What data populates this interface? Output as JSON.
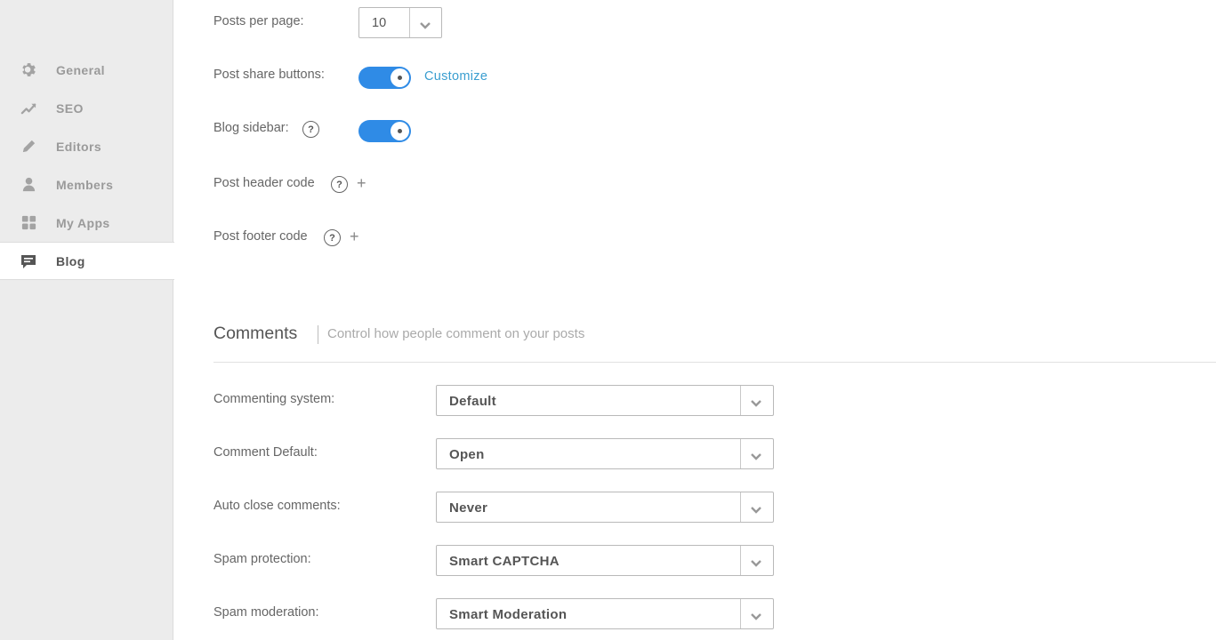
{
  "sidebar": {
    "items": [
      {
        "label": "General",
        "icon": "gear-icon"
      },
      {
        "label": "SEO",
        "icon": "trend-icon"
      },
      {
        "label": "Editors",
        "icon": "pencil-icon"
      },
      {
        "label": "Members",
        "icon": "person-icon"
      },
      {
        "label": "My Apps",
        "icon": "grid-icon"
      },
      {
        "label": "Blog",
        "icon": "comment-icon",
        "active": true
      }
    ]
  },
  "blog": {
    "posts_per_page_label": "Posts per page:",
    "posts_per_page_value": "10",
    "share_buttons_label": "Post share buttons:",
    "share_buttons_on": true,
    "customize_label": "Customize",
    "sidebar_label": "Blog sidebar:",
    "sidebar_on": true,
    "help_glyph": "?",
    "plus_glyph": "+",
    "header_code_label": "Post header code",
    "footer_code_label": "Post footer code"
  },
  "comments": {
    "title": "Comments",
    "subtitle": "Control how people comment on your posts",
    "rows": [
      {
        "label": "Commenting system:",
        "value": "Default"
      },
      {
        "label": "Comment Default:",
        "value": "Open"
      },
      {
        "label": "Auto close comments:",
        "value": "Never"
      },
      {
        "label": "Spam protection:",
        "value": "Smart CAPTCHA"
      },
      {
        "label": "Spam moderation:",
        "value": "Smart Moderation"
      }
    ]
  },
  "colors": {
    "accent": "#2f8be6",
    "link": "#3a9ed0",
    "sidebar_bg": "#ececec"
  }
}
